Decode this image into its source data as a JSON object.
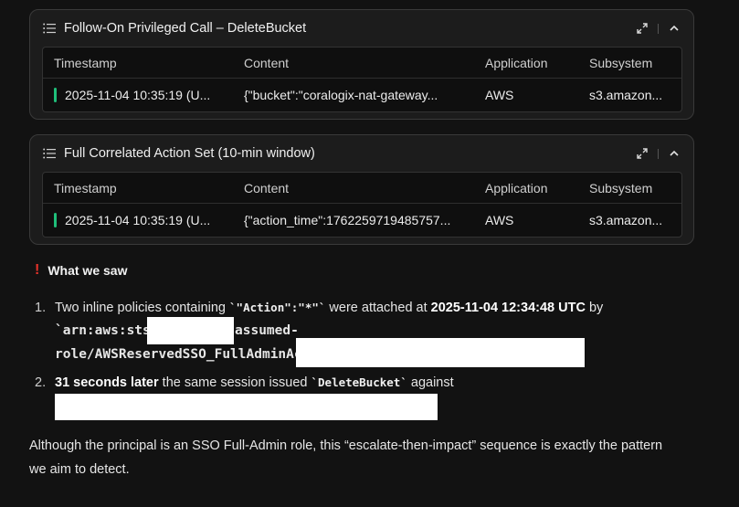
{
  "cards": [
    {
      "title": "Follow-On Privileged Call – DeleteBucket",
      "columns": [
        "Timestamp",
        "Content",
        "Application",
        "Subsystem"
      ],
      "row": {
        "timestamp": "2025-11-04 10:35:19 (U...",
        "content": "{\"bucket\":\"coralogix-nat-gateway...",
        "application": "AWS",
        "subsystem": "s3.amazon..."
      }
    },
    {
      "title": "Full Correlated Action Set (10-min window)",
      "columns": [
        "Timestamp",
        "Content",
        "Application",
        "Subsystem"
      ],
      "row": {
        "timestamp": "2025-11-04 10:35:19 (U...",
        "content": "{\"action_time\":1762259719485757...",
        "application": "AWS",
        "subsystem": "s3.amazon..."
      }
    }
  ],
  "colors": {
    "background": "#121212",
    "severity": "#1fbf7a",
    "alert": "#e8322a"
  },
  "section": {
    "alert_icon": "!",
    "heading": "What we saw"
  },
  "items": [
    {
      "number": "1.",
      "t1": "Two inline policies containing ",
      "code1": "`\"Action\":\"*\"`",
      "t2": " were attached at ",
      "bold1": "2025-11-04 12:34:48 UTC",
      "t3": " by",
      "code2a": "`arn:aws:sts::",
      "code2b": "assumed-",
      "code2c": "role/AWSReservedSSO_FullAdminAccess_"
    },
    {
      "number": "2.",
      "bold1": "31 seconds later",
      "t1": " the same session issued ",
      "code1": "`DeleteBucket`",
      "t2": " against"
    }
  ],
  "summary_line1": "Although the principal is an SSO Full-Admin role, this “escalate-then-impact” sequence is exactly the pattern",
  "summary_line2": "we aim to detect."
}
